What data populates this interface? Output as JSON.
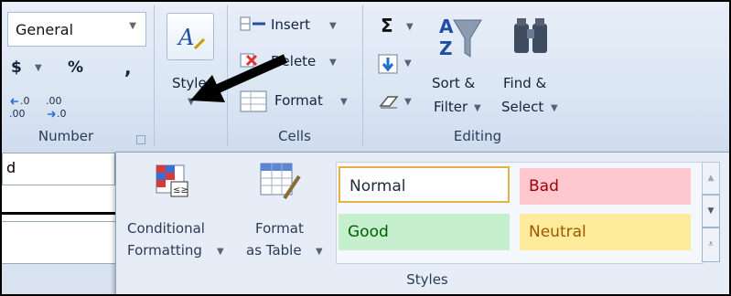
{
  "number_group": {
    "format_value": "General",
    "currency_symbol": "$",
    "percent_symbol": "%",
    "comma_symbol": ",",
    "increase_decimal": "←.0\n.00",
    "decrease_decimal": ".00\n→.0",
    "label": "Number"
  },
  "styles_group_button": {
    "label": "Styles"
  },
  "cells_group": {
    "insert_label": "Insert",
    "delete_label": "Delete",
    "format_label": "Format",
    "label": "Cells"
  },
  "editing_group": {
    "sum_symbol": "Σ",
    "sort_filter_line1": "Sort &",
    "sort_filter_line2": "Filter",
    "find_select_line1": "Find &",
    "find_select_line2": "Select",
    "label": "Editing"
  },
  "sheet": {
    "namebox_value": "d"
  },
  "styles_popup": {
    "conditional_line1": "Conditional",
    "conditional_line2": "Formatting",
    "format_table_line1": "Format",
    "format_table_line2": "as Table",
    "cell_styles": [
      {
        "label": "Normal",
        "bg": "#ffffff",
        "color": "#1f2a3a"
      },
      {
        "label": "Bad",
        "bg": "#ffc7ce",
        "color": "#9c0006"
      },
      {
        "label": "Good",
        "bg": "#c6efce",
        "color": "#006100"
      },
      {
        "label": "Neutral",
        "bg": "#ffeb9c",
        "color": "#9c5700"
      }
    ],
    "label": "Styles"
  }
}
